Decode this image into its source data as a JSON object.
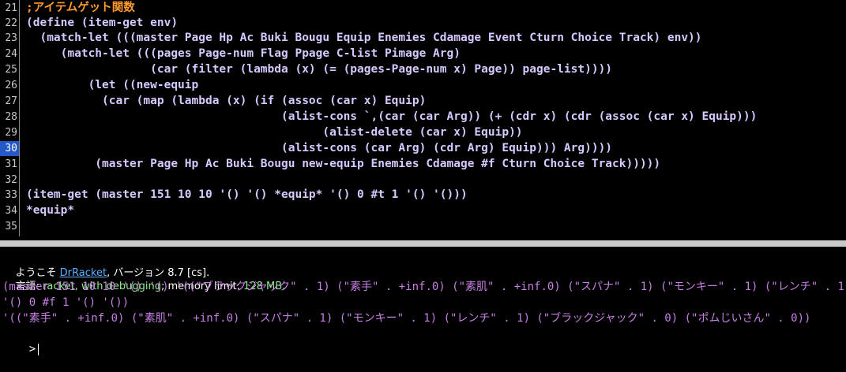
{
  "editor": {
    "line_numbers": [
      "21",
      "22",
      "23",
      "24",
      "25",
      "26",
      "27",
      "28",
      "29",
      "30",
      "31",
      "32",
      "33",
      "34",
      "35"
    ],
    "current_line": "30",
    "lines": {
      "l21": ";アイテムゲット関数",
      "l22": "(define (item-get env)",
      "l23": "  (match-let (((master Page Hp Ac Buki Bougu Equip Enemies Cdamage Event Cturn Choice Track) env))",
      "l24": "     (match-let (((pages Page-num Flag Ppage C-list Pimage Arg)",
      "l25": "                  (car (filter (lambda (x) (= (pages-Page-num x) Page)) page-list))))",
      "l26": "         (let ((new-equip",
      "l27": "           (car (map (lambda (x) (if (assoc (car x) Equip)",
      "l28": "                                     (alist-cons `,(car (car Arg)) (+ (cdr x) (cdr (assoc (car x) Equip)))",
      "l29": "                                           (alist-delete (car x) Equip))",
      "l30": "                                     (alist-cons (car Arg) (cdr Arg) Equip))) Arg))))",
      "l31": "          (master Page Hp Ac Buki Bougu new-equip Enemies Cdamage #f Cturn Choice Track)))))",
      "l32": "",
      "l33": "(item-get (master 151 10 10 '() '() *equip* '() 0 #t 1 '() '()))",
      "l34": "*equip*",
      "l35": ""
    }
  },
  "repl": {
    "welcome_prefix": "ようこそ ",
    "welcome_link": "DrRacket",
    "welcome_suffix": ", バージョン 8.7 [cs].",
    "lang_prefix": "言語: ",
    "lang_value": "racket, with debugging",
    "lang_mid": "; memory limit: ",
    "memory_value": "128 MB",
    "lang_end": ".",
    "out1": "(master 151 10 10 '() '() '((\"ブラックジャック\" . 1) (\"素手\" . +inf.0) (\"素肌\" . +inf.0) (\"スパナ\" . 1) (\"モンキー\" . 1) (\"レンチ\" . 1)",
    "out2": "'() 0 #f 1 '() '())",
    "out3": "'((\"素手\" . +inf.0) (\"素肌\" . +inf.0) (\"スパナ\" . 1) (\"モンキー\" . 1) (\"レンチ\" . 1) (\"ブラックジャック\" . 0) (\"ポムじいさん\" . 0))",
    "prompt": ">"
  }
}
